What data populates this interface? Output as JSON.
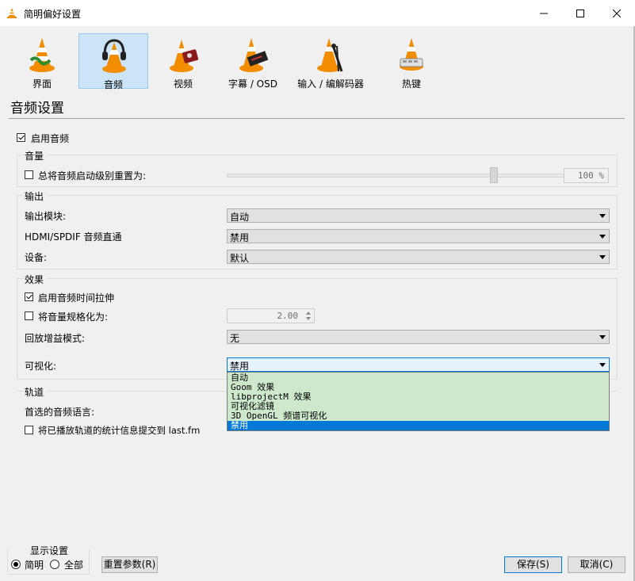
{
  "window": {
    "title": "简明偏好设置"
  },
  "categories": [
    {
      "label": "界面",
      "active": false
    },
    {
      "label": "音频",
      "active": true
    },
    {
      "label": "视频",
      "active": false
    },
    {
      "label": "字幕 / OSD",
      "active": false
    },
    {
      "label": "输入 / 编解码器",
      "active": false
    },
    {
      "label": "热键",
      "active": false
    }
  ],
  "section_title": "音频设置",
  "enable_audio": {
    "label": "启用音频",
    "checked": true
  },
  "volume": {
    "group_title": "音量",
    "reset_label": "总将音频启动级别重置为:",
    "reset_checked": false,
    "value": "100 %",
    "slider_level": 0.79
  },
  "output": {
    "group_title": "输出",
    "module_label": "输出模块:",
    "module_value": "自动",
    "passthrough_label": "HDMI/SPDIF 音频直通",
    "passthrough_value": "禁用",
    "device_label": "设备:",
    "device_value": "默认"
  },
  "effects": {
    "group_title": "效果",
    "stretch_label": "启用音频时间拉伸",
    "stretch_checked": true,
    "normalize_label": "将音量规格化为:",
    "normalize_checked": false,
    "normalize_value": "2.00",
    "replaygain_label": "回放增益模式:",
    "replaygain_value": "无",
    "viz_label": "可视化:",
    "viz_value": "禁用",
    "viz_options": [
      "自动",
      "Goom 效果",
      "libprojectM 效果",
      "可视化滤镜",
      "3D OpenGL 频谱可视化",
      "禁用"
    ],
    "viz_selected_index": 5
  },
  "tracks": {
    "group_title": "轨道",
    "lang_label": "首选的音频语言:",
    "lastfm_label": "将已播放轨道的统计信息提交到 last.fm",
    "lastfm_checked": false
  },
  "display": {
    "group_title": "显示设置",
    "simple_label": "简明",
    "all_label": "全部",
    "selected": "simple"
  },
  "buttons": {
    "reset": "重置参数(R)",
    "save": "保存(S)",
    "cancel": "取消(C)"
  },
  "colors": {
    "active_tab": "#cce4f7",
    "dropdown_bg": "#cde8cd",
    "selection": "#0078d7",
    "cone_orange": "#f28c00"
  }
}
